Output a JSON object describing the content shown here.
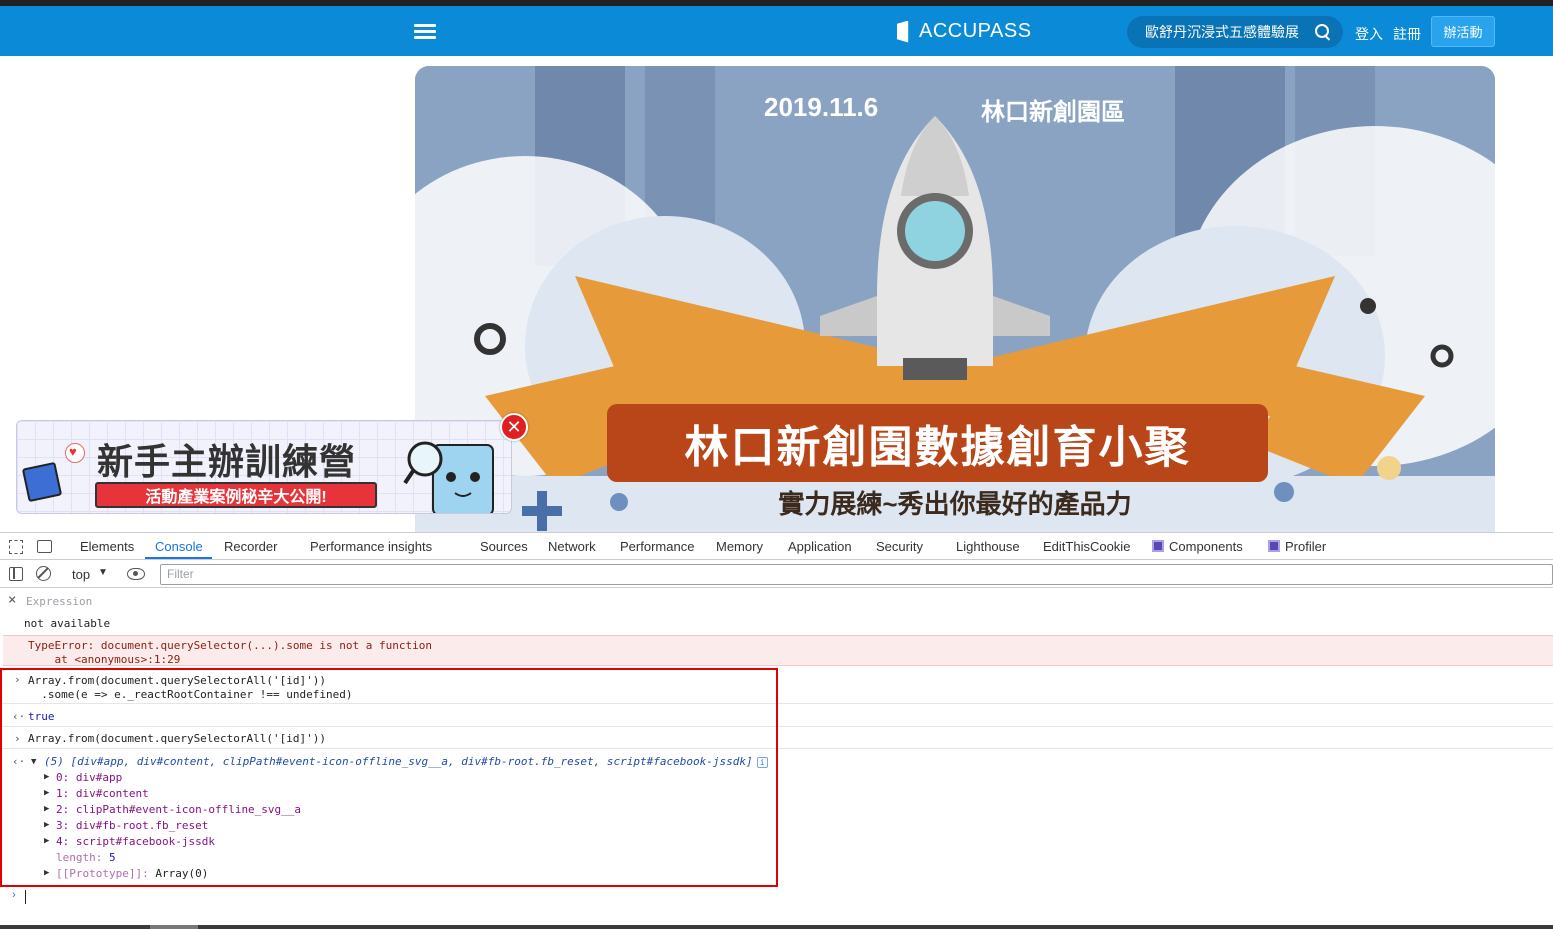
{
  "header": {
    "logo": "ACCUPASS",
    "search_text": "歐舒丹沉浸式五感體驗展",
    "login": "登入",
    "register": "註冊",
    "host_button": "辦活動"
  },
  "banner": {
    "date": "2019.11.6",
    "location": "林口新創園區",
    "title": "林口新創園數據創育小聚",
    "subtitle": "實力展練~秀出你最好的產品力"
  },
  "promo": {
    "title": "新手主辦訓練營",
    "subtitle": "活動產業案例秘辛大公開!"
  },
  "devtools": {
    "tabs": [
      "Elements",
      "Console",
      "Recorder",
      "Performance insights",
      "Sources",
      "Network",
      "Performance",
      "Memory",
      "Application",
      "Security",
      "Lighthouse",
      "EditThisCookie",
      "Components",
      "Profiler"
    ],
    "active_tab": "Console",
    "context": "top",
    "filter_placeholder": "Filter",
    "expression_label": "Expression",
    "expression_value": "not available",
    "error_line1": "TypeError: document.querySelector(...).some is not a function",
    "error_line2": "    at <anonymous>:1:29",
    "cmd1_line1": "Array.from(document.querySelectorAll('[id]'))",
    "cmd1_line2": "  .some(e => e._reactRootContainer !== undefined)",
    "result1": "true",
    "cmd2": "Array.from(document.querySelectorAll('[id]'))",
    "result2_summary": "(5) [div#app, div#content, clipPath#event-icon-offline_svg__a, div#fb-root.fb_reset, script#facebook-jssdk]",
    "items": [
      {
        "key": "0:",
        "value": "div#app"
      },
      {
        "key": "1:",
        "value": "div#content"
      },
      {
        "key": "2:",
        "value": "clipPath#event-icon-offline_svg__a"
      },
      {
        "key": "3:",
        "value": "div#fb-root.fb_reset"
      },
      {
        "key": "4:",
        "value": "script#facebook-jssdk"
      }
    ],
    "length_key": "length:",
    "length_value": "5",
    "prototype_key": "[[Prototype]]:",
    "prototype_value": "Array(0)"
  },
  "colors": {
    "header_bg": "#0b8ad7",
    "accent": "#1a73e8",
    "highlight_box": "#e00000",
    "error_bg": "#fcebeb"
  }
}
